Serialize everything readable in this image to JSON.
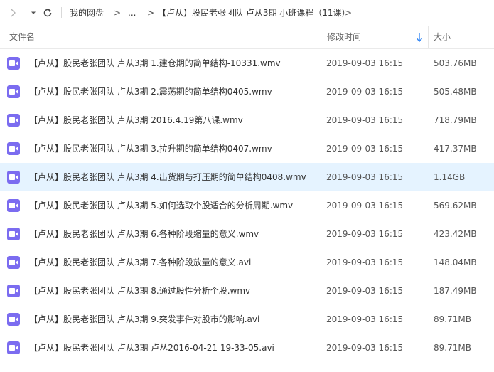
{
  "nav": {
    "breadcrumb_root": "我的网盘",
    "breadcrumb_ellipsis": "...",
    "breadcrumb_current": "【卢从】股民老张团队 卢从3期 小班课程（11课）",
    "arrow": ">"
  },
  "columns": {
    "name": "文件名",
    "modified": "修改时间",
    "size": "大小"
  },
  "colors": {
    "accent": "#3b8cf5",
    "video_icon": "#7b6cf0",
    "selected_row": "#e5f3ff"
  },
  "files": [
    {
      "name": "【卢从】股民老张团队 卢从3期  1.建仓期的简单结构-10331.wmv",
      "modified": "2019-09-03 16:15",
      "size": "503.76MB",
      "icon": "video-icon"
    },
    {
      "name": "【卢从】股民老张团队 卢从3期  2.震荡期的简单结构0405.wmv",
      "modified": "2019-09-03 16:15",
      "size": "505.48MB",
      "icon": "video-icon"
    },
    {
      "name": "【卢从】股民老张团队 卢从3期  2016.4.19第八课.wmv",
      "modified": "2019-09-03 16:15",
      "size": "718.79MB",
      "icon": "video-icon"
    },
    {
      "name": "【卢从】股民老张团队 卢从3期  3.拉升期的简单结构0407.wmv",
      "modified": "2019-09-03 16:15",
      "size": "417.37MB",
      "icon": "video-icon"
    },
    {
      "name": "【卢从】股民老张团队 卢从3期  4.出货期与打压期的简单结构0408.wmv",
      "modified": "2019-09-03 16:15",
      "size": "1.14GB",
      "icon": "video-icon",
      "selected": true
    },
    {
      "name": "【卢从】股民老张团队 卢从3期  5.如何选取个股适合的分析周期.wmv",
      "modified": "2019-09-03 16:15",
      "size": "569.62MB",
      "icon": "video-icon"
    },
    {
      "name": "【卢从】股民老张团队 卢从3期  6.各种阶段缩量的意义.wmv",
      "modified": "2019-09-03 16:15",
      "size": "423.42MB",
      "icon": "video-icon"
    },
    {
      "name": "【卢从】股民老张团队 卢从3期  7.各种阶段放量的意义.avi",
      "modified": "2019-09-03 16:15",
      "size": "148.04MB",
      "icon": "video-icon"
    },
    {
      "name": "【卢从】股民老张团队 卢从3期  8.通过股性分析个股.wmv",
      "modified": "2019-09-03 16:15",
      "size": "187.49MB",
      "icon": "video-icon"
    },
    {
      "name": "【卢从】股民老张团队 卢从3期  9.突发事件对股市的影响.avi",
      "modified": "2019-09-03 16:15",
      "size": "89.71MB",
      "icon": "video-icon"
    },
    {
      "name": "【卢从】股民老张团队 卢从3期  卢丛2016-04-21 19-33-05.avi",
      "modified": "2019-09-03 16:15",
      "size": "89.71MB",
      "icon": "video-icon"
    }
  ]
}
